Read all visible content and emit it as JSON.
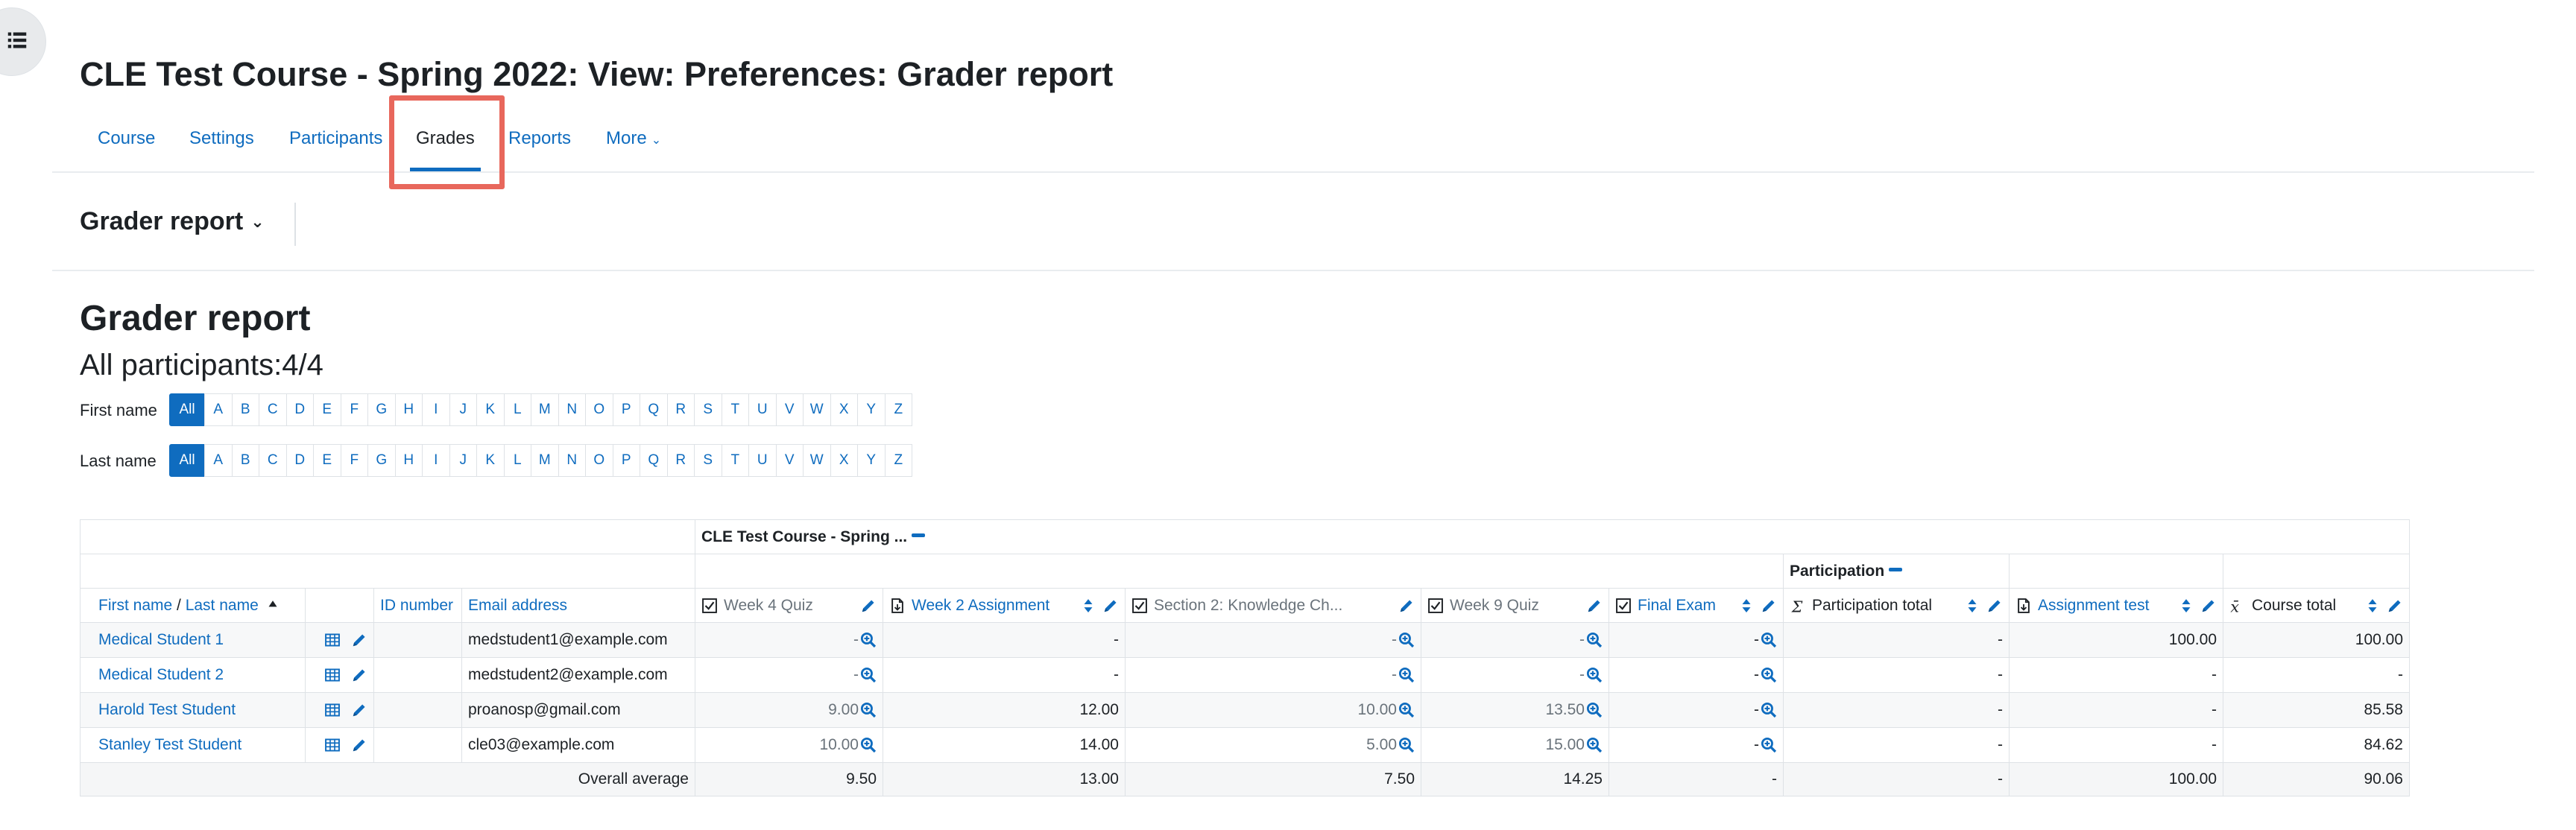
{
  "page": {
    "title": "CLE Test Course - Spring 2022: View: Preferences: Grader report"
  },
  "nav": {
    "tabs": [
      {
        "label": "Course"
      },
      {
        "label": "Settings"
      },
      {
        "label": "Participants"
      },
      {
        "label": "Grades"
      },
      {
        "label": "Reports"
      },
      {
        "label": "More"
      }
    ],
    "active": "Grades"
  },
  "tertiary": {
    "selector_label": "Grader report"
  },
  "report": {
    "heading": "Grader report",
    "participants": "All participants:4/4",
    "first_name_label": "First name",
    "last_name_label": "Last name",
    "initials": [
      "All",
      "A",
      "B",
      "C",
      "D",
      "E",
      "F",
      "G",
      "H",
      "I",
      "J",
      "K",
      "L",
      "M",
      "N",
      "O",
      "P",
      "Q",
      "R",
      "S",
      "T",
      "U",
      "V",
      "W",
      "X",
      "Y",
      "Z"
    ]
  },
  "grades": {
    "category_top": "CLE Test Course - Spring ...",
    "category_sub": "Participation",
    "columns": {
      "name_first": "First name",
      "name_sep": " / ",
      "name_last": "Last name",
      "idnumber": "ID number",
      "email": "Email address",
      "items": [
        "Week 4 Quiz",
        "Week 2 Assignment",
        "Section 2: Knowledge Ch...",
        "Week 9 Quiz",
        "Final Exam",
        "Participation total",
        "Assignment test",
        "Course total"
      ]
    },
    "students": [
      {
        "name": "Medical Student 1",
        "email": "medstudent1@example.com",
        "grades": [
          "-",
          "-",
          "-",
          "-",
          "-",
          "-",
          "100.00",
          "100.00"
        ]
      },
      {
        "name": "Medical Student 2",
        "email": "medstudent2@example.com",
        "grades": [
          "-",
          "-",
          "-",
          "-",
          "-",
          "-",
          "-",
          "-"
        ]
      },
      {
        "name": "Harold Test Student",
        "email": "proanosp@gmail.com",
        "grades": [
          "9.00",
          "12.00",
          "10.00",
          "13.50",
          "-",
          "-",
          "-",
          "85.58"
        ]
      },
      {
        "name": "Stanley Test Student",
        "email": "cle03@example.com",
        "grades": [
          "10.00",
          "14.00",
          "5.00",
          "15.00",
          "-",
          "-",
          "-",
          "84.62"
        ]
      }
    ],
    "average": {
      "label": "Overall average",
      "values": [
        "9.50",
        "13.00",
        "7.50",
        "14.25",
        "-",
        "-",
        "100.00",
        "90.06"
      ]
    }
  },
  "colors": {
    "link": "#0f6cbf",
    "highlight": "#e8675c"
  },
  "icons": {
    "drawer": "list-icon",
    "sort_asc": "sort-asc-icon",
    "sort": "sort-icon",
    "edit": "pencil-icon",
    "zoom": "zoom-in-icon",
    "grades_table": "table-icon",
    "quiz": "checkbox-icon",
    "assignment": "document-icon",
    "sum": "sigma-icon",
    "calc": "function-icon"
  }
}
